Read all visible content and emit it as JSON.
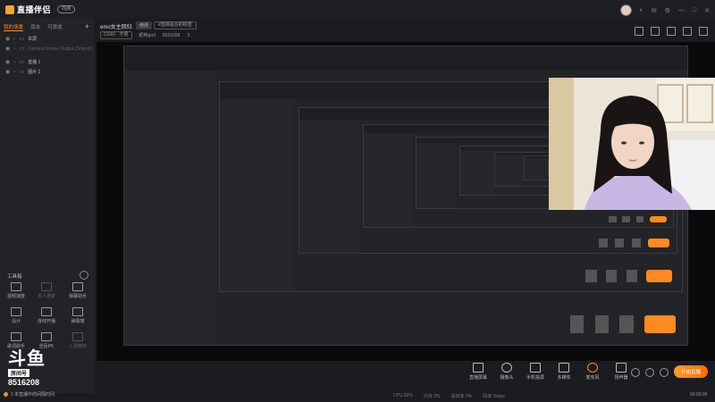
{
  "app": {
    "logo_text": "直播伴侣",
    "beta_label": "内测"
  },
  "window_icons": [
    "skin-icon",
    "message-icon",
    "settings-icon",
    "minimize-icon",
    "maximize-icon",
    "close-icon"
  ],
  "sidebar": {
    "tabs": [
      "我的场景",
      "双击",
      "可添加"
    ],
    "scenes": [
      {
        "name": "本屏",
        "dim": false
      },
      {
        "name": "Camera Screen Output (ShareD)",
        "dim": true
      },
      {
        "name": "直播 1",
        "dim": false
      },
      {
        "name": "图片 2",
        "dim": false
      }
    ],
    "tools_title": "工具箱",
    "tools": [
      {
        "label": "视频速度",
        "dim": false
      },
      {
        "label": "多人连麦",
        "dim": true
      },
      {
        "label": "弹幕助手",
        "dim": false
      },
      {
        "label": "设计",
        "dim": false
      },
      {
        "label": "连线开播",
        "dim": false
      },
      {
        "label": "弹幕墙",
        "dim": false
      },
      {
        "label": "歌词助手",
        "dim": false
      },
      {
        "label": "全民PK",
        "dim": false
      },
      {
        "label": "入场特效",
        "dim": true
      }
    ],
    "douyu": {
      "big": "斗鱼",
      "room_label": "房间号",
      "room_number": "8516208"
    },
    "status": "1 本直播中的间隔时间"
  },
  "header": {
    "room_title": "emo女主回归",
    "modify": "修改",
    "category": "#选择适合的标签",
    "quality": "CG60 · 不限",
    "nick": "昵称god",
    "room_id": "8516208",
    "fans": "3"
  },
  "bottom": {
    "tools": [
      {
        "label": "直播屏幕",
        "icon": "screen-icon"
      },
      {
        "label": "摄像头",
        "icon": "camera-icon"
      },
      {
        "label": "手机投屏",
        "icon": "phone-icon"
      },
      {
        "label": "多媒体",
        "icon": "media-icon"
      },
      {
        "label": "麦克风",
        "icon": "mic-icon"
      },
      {
        "label": "扬声器",
        "icon": "speaker-icon"
      }
    ],
    "start": "开始直播",
    "stats": [
      "CPU 82%",
      "内存 2%",
      "丢帧率 0%",
      "码率 0kbps"
    ],
    "time": "00:00:00"
  }
}
